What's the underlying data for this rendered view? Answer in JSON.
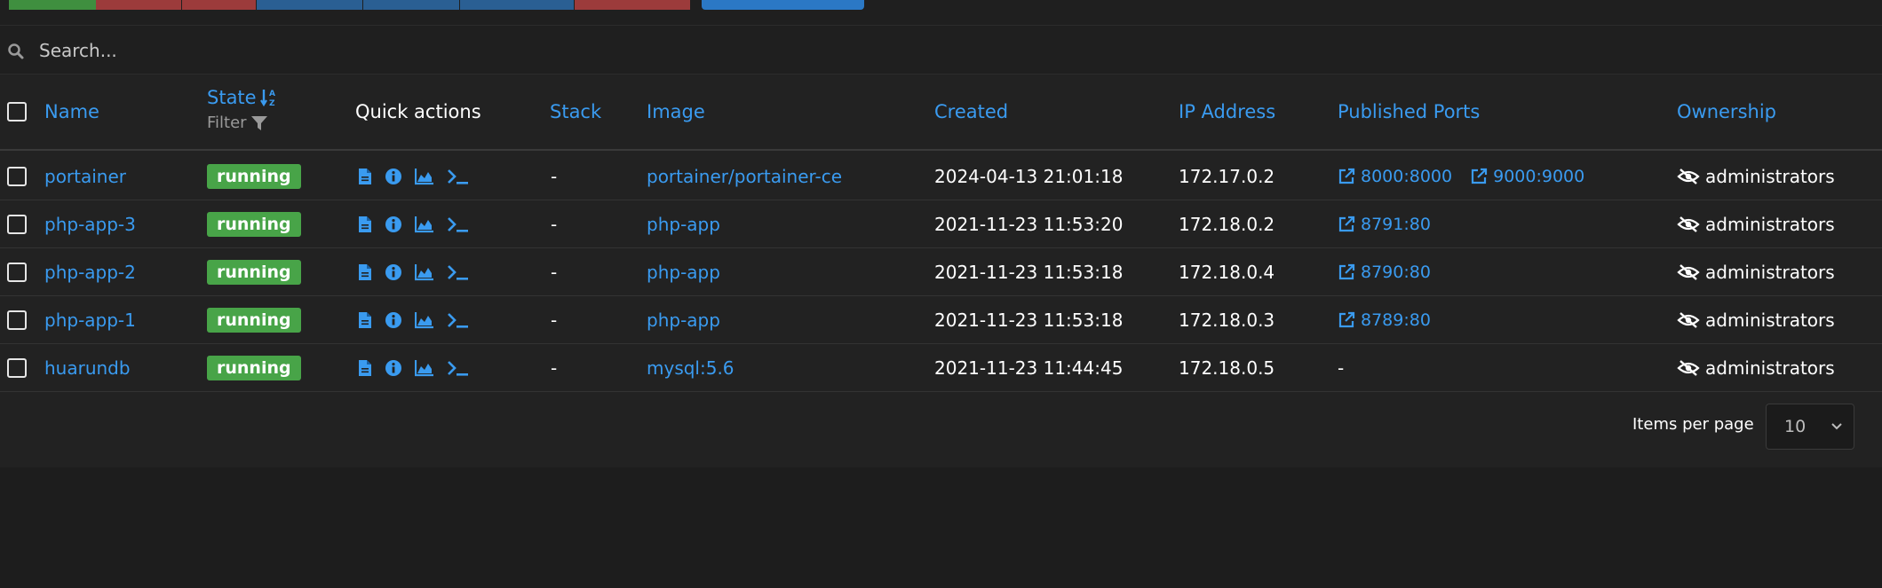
{
  "search": {
    "placeholder": "Search..."
  },
  "columns": {
    "name": "Name",
    "state": "State",
    "state_filter": "Filter",
    "quick_actions": "Quick actions",
    "stack": "Stack",
    "image": "Image",
    "created": "Created",
    "ip": "IP Address",
    "ports": "Published Ports",
    "ownership": "Ownership"
  },
  "rows": [
    {
      "name": "portainer",
      "state": "running",
      "stack": "-",
      "image": "portainer/portainer-ce",
      "created": "2024-04-13 21:01:18",
      "ip": "172.17.0.2",
      "ports": [
        "8000:8000",
        "9000:9000"
      ],
      "ownership": "administrators"
    },
    {
      "name": "php-app-3",
      "state": "running",
      "stack": "-",
      "image": "php-app",
      "created": "2021-11-23 11:53:20",
      "ip": "172.18.0.2",
      "ports": [
        "8791:80"
      ],
      "ownership": "administrators"
    },
    {
      "name": "php-app-2",
      "state": "running",
      "stack": "-",
      "image": "php-app",
      "created": "2021-11-23 11:53:18",
      "ip": "172.18.0.4",
      "ports": [
        "8790:80"
      ],
      "ownership": "administrators"
    },
    {
      "name": "php-app-1",
      "state": "running",
      "stack": "-",
      "image": "php-app",
      "created": "2021-11-23 11:53:18",
      "ip": "172.18.0.3",
      "ports": [
        "8789:80"
      ],
      "ownership": "administrators"
    },
    {
      "name": "huarundb",
      "state": "running",
      "stack": "-",
      "image": "mysql:5.6",
      "created": "2021-11-23 11:44:45",
      "ip": "172.18.0.5",
      "ports_text": "-",
      "ports": [],
      "ownership": "administrators"
    }
  ],
  "pagination": {
    "items_per_page_label": "Items per page",
    "items_per_page_value": "10"
  },
  "colors": {
    "accent": "#3a9bf0",
    "running": "#48a448",
    "background": "#1d1d1d"
  },
  "icons": {
    "quick_actions": [
      "logs-icon",
      "inspect-icon",
      "stats-icon",
      "console-icon"
    ],
    "port": "external-link-icon",
    "ownership": "eye-slash-icon",
    "sort": "sort-alpha-icon",
    "filter": "filter-icon"
  }
}
